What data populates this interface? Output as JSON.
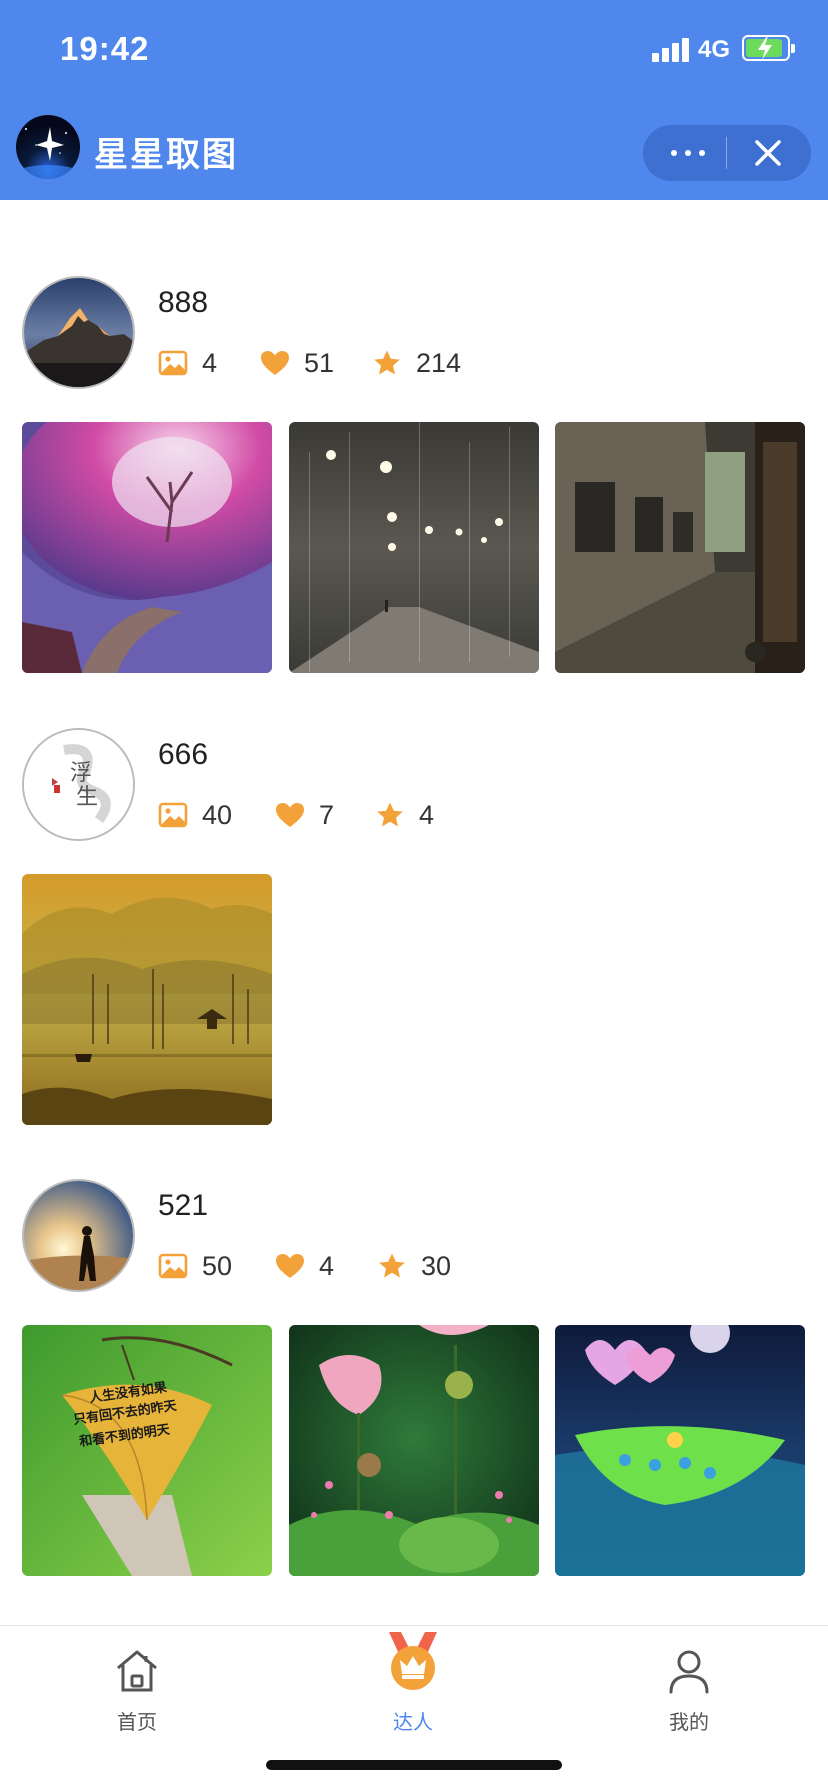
{
  "status_bar": {
    "time": "19:42",
    "network": "4G"
  },
  "navbar": {
    "title": "星星取图"
  },
  "users": [
    {
      "name": "888",
      "stats": {
        "images": "4",
        "likes": "51",
        "favorites": "214"
      }
    },
    {
      "name": "666",
      "stats": {
        "images": "40",
        "likes": "7",
        "favorites": "4"
      }
    },
    {
      "name": "521",
      "stats": {
        "images": "50",
        "likes": "4",
        "favorites": "30"
      }
    }
  ],
  "thumb_text": "人生没有如果 只有回不去的昨天 和看不到的明天",
  "tabbar": {
    "items": [
      {
        "label": "首页",
        "icon": "home-icon",
        "active": false
      },
      {
        "label": "达人",
        "icon": "crown-medal-icon",
        "active": true
      },
      {
        "label": "我的",
        "icon": "person-icon",
        "active": false
      }
    ]
  },
  "colors": {
    "primary": "#4f87ec",
    "accent": "#f3a23a"
  }
}
